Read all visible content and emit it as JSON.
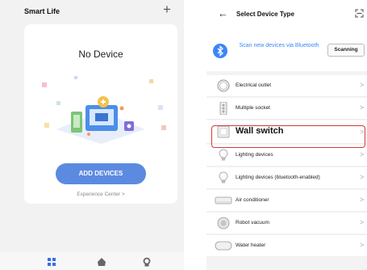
{
  "left_screen": {
    "app_title": "Smart Life",
    "plus_symbol": "+",
    "empty_state_title": "No Device",
    "add_button_label": "ADD DEVICES",
    "experience_center_link": "Experience Center >",
    "tabs": [
      {
        "icon": "home-grid-icon",
        "color": "#3a6fe0"
      },
      {
        "icon": "scene-icon",
        "color": "#666666"
      },
      {
        "icon": "profile-icon",
        "color": "#666666"
      }
    ]
  },
  "right_screen": {
    "back_symbol": "←",
    "title": "Select Device Type",
    "bluetooth_prompt": "Scan new devices via Bluetooth",
    "scanning_label": "Scanning",
    "devices": [
      {
        "label": "Electrical outlet",
        "icon": "outlet-icon"
      },
      {
        "label": "Multiple socket",
        "icon": "power-strip-icon"
      },
      {
        "label": "Wall switch",
        "icon": "wall-switch-icon",
        "highlighted": true
      },
      {
        "label": "Lighting devices",
        "icon": "bulb-icon"
      },
      {
        "label": "Lighting devices (bluetooth-enabled)",
        "icon": "bulb-icon"
      },
      {
        "label": "Air conditioner",
        "icon": "air-conditioner-icon"
      },
      {
        "label": "Robot vacuum",
        "icon": "robot-vacuum-icon"
      },
      {
        "label": "Water heater",
        "icon": "water-heater-icon"
      }
    ],
    "chevron_symbol": ">"
  },
  "colors": {
    "accent_blue": "#5b8ae0",
    "bluetooth_blue": "#3a86f7",
    "highlight_red": "#d23a3a"
  }
}
